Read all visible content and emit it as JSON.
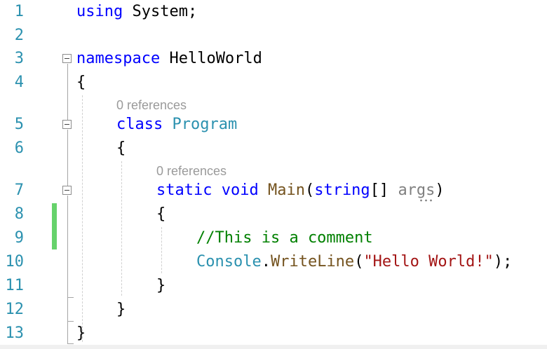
{
  "editor": {
    "line_numbers": [
      "1",
      "2",
      "3",
      "4",
      "5",
      "6",
      "7",
      "8",
      "9",
      "10",
      "11",
      "12",
      "13"
    ],
    "lines": {
      "l1": {
        "kw": "using",
        "rest": " System;"
      },
      "l3": {
        "kw": "namespace",
        "rest": " HelloWorld"
      },
      "l4": {
        "text": "{"
      },
      "l5": {
        "kw": "class",
        "type": "Program"
      },
      "l6": {
        "text": "{"
      },
      "l7": {
        "static": "static",
        "void": "void",
        "method": "Main",
        "open": "(",
        "string": "string",
        "brackets": "[] ",
        "param": "args",
        "close": ")"
      },
      "l8": {
        "text": "{"
      },
      "l9": {
        "comment": "//This is a comment"
      },
      "l10": {
        "type": "Console",
        "dot": ".",
        "method": "WriteLine",
        "open": "(",
        "str": "\"Hello World!\"",
        "close": ");"
      },
      "l11": {
        "text": "}"
      },
      "l12": {
        "text": "}"
      },
      "l13": {
        "text": "}"
      }
    },
    "codelens": {
      "class_refs": "0 references",
      "main_refs": "0 references"
    }
  },
  "colors": {
    "keyword": "#0000ff",
    "type": "#2b91af",
    "method": "#74531f",
    "string": "#a31515",
    "comment": "#008000",
    "line_number": "#2b91af",
    "change_bar": "#66d26b"
  },
  "icons": [
    "fold-collapse-icon",
    "squiggle-hint-icon"
  ]
}
